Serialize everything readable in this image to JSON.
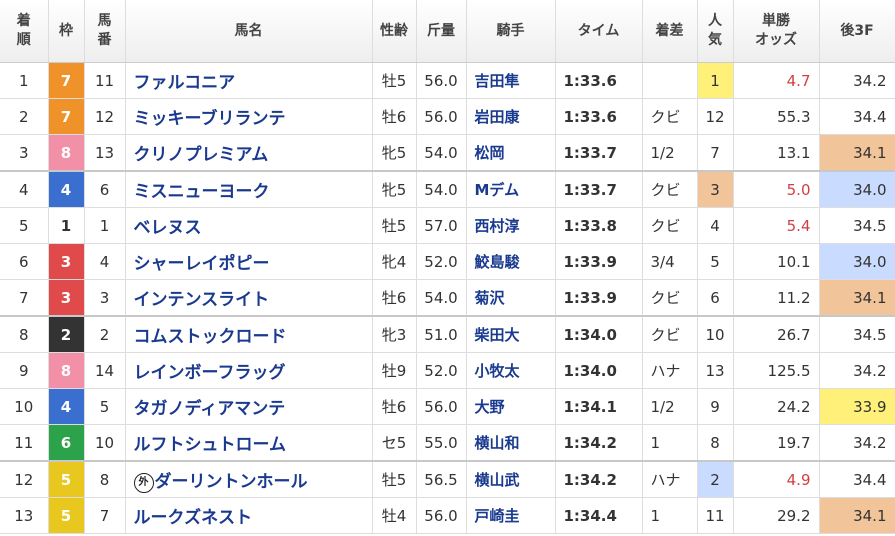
{
  "headers": {
    "rank": [
      "着",
      "順"
    ],
    "waku": "枠",
    "umaban": [
      "馬",
      "番"
    ],
    "name": "馬名",
    "sexage": "性齢",
    "weight": "斤量",
    "jockey": "騎手",
    "time": "タイム",
    "margin": "着差",
    "pop": [
      "人",
      "気"
    ],
    "odds": [
      "単勝",
      "オッズ"
    ],
    "last3f": "後3F"
  },
  "colors": {
    "waku_1": "#ffffff",
    "waku_2": "#333333",
    "waku_3": "#e04a4a",
    "waku_4": "#3a6fd0",
    "waku_5": "#e8c81e",
    "waku_6": "#2ca34a",
    "waku_7": "#f0922a",
    "waku_8": "#f290a8",
    "pop1_bg": "#fff07a",
    "pop2_bg": "#c9dcff",
    "pop3_bg": "#f2c49a",
    "f1_bg": "#fff07a",
    "f2_bg": "#c9dcff",
    "f3_bg": "#f2c49a"
  },
  "rows": [
    {
      "rank": "1",
      "waku": "7",
      "umaban": "11",
      "name": "ファルコニア",
      "gai": "",
      "sexage": "牡5",
      "weight": "56.0",
      "jockey": "吉田隼",
      "time": "1:33.6",
      "margin": "",
      "pop": "1",
      "odds": "4.7",
      "last3f": "34.2"
    },
    {
      "rank": "2",
      "waku": "7",
      "umaban": "12",
      "name": "ミッキーブリランテ",
      "gai": "",
      "sexage": "牡6",
      "weight": "56.0",
      "jockey": "岩田康",
      "time": "1:33.6",
      "margin": "クビ",
      "pop": "12",
      "odds": "55.3",
      "last3f": "34.4"
    },
    {
      "rank": "3",
      "waku": "8",
      "umaban": "13",
      "name": "クリノプレミアム",
      "gai": "",
      "sexage": "牝5",
      "weight": "54.0",
      "jockey": "松岡",
      "time": "1:33.7",
      "margin": "1/2",
      "pop": "7",
      "odds": "13.1",
      "last3f": "34.1"
    },
    {
      "rank": "4",
      "waku": "4",
      "umaban": "6",
      "name": "ミスニューヨーク",
      "gai": "",
      "sexage": "牝5",
      "weight": "54.0",
      "jockey": "Mデム",
      "time": "1:33.7",
      "margin": "クビ",
      "pop": "3",
      "odds": "5.0",
      "last3f": "34.0"
    },
    {
      "rank": "5",
      "waku": "1",
      "umaban": "1",
      "name": "ベレヌス",
      "gai": "",
      "sexage": "牡5",
      "weight": "57.0",
      "jockey": "西村淳",
      "time": "1:33.8",
      "margin": "クビ",
      "pop": "4",
      "odds": "5.4",
      "last3f": "34.5"
    },
    {
      "rank": "6",
      "waku": "3",
      "umaban": "4",
      "name": "シャーレイポピー",
      "gai": "",
      "sexage": "牝4",
      "weight": "52.0",
      "jockey": "鮫島駿",
      "time": "1:33.9",
      "margin": "3/4",
      "pop": "5",
      "odds": "10.1",
      "last3f": "34.0"
    },
    {
      "rank": "7",
      "waku": "3",
      "umaban": "3",
      "name": "インテンスライト",
      "gai": "",
      "sexage": "牡6",
      "weight": "54.0",
      "jockey": "菊沢",
      "time": "1:33.9",
      "margin": "クビ",
      "pop": "6",
      "odds": "11.2",
      "last3f": "34.1"
    },
    {
      "rank": "8",
      "waku": "2",
      "umaban": "2",
      "name": "コムストックロード",
      "gai": "",
      "sexage": "牝3",
      "weight": "51.0",
      "jockey": "柴田大",
      "time": "1:34.0",
      "margin": "クビ",
      "pop": "10",
      "odds": "26.7",
      "last3f": "34.5"
    },
    {
      "rank": "9",
      "waku": "8",
      "umaban": "14",
      "name": "レインボーフラッグ",
      "gai": "",
      "sexage": "牡9",
      "weight": "52.0",
      "jockey": "小牧太",
      "time": "1:34.0",
      "margin": "ハナ",
      "pop": "13",
      "odds": "125.5",
      "last3f": "34.2"
    },
    {
      "rank": "10",
      "waku": "4",
      "umaban": "5",
      "name": "タガノディアマンテ",
      "gai": "",
      "sexage": "牡6",
      "weight": "56.0",
      "jockey": "大野",
      "time": "1:34.1",
      "margin": "1/2",
      "pop": "9",
      "odds": "24.2",
      "last3f": "33.9"
    },
    {
      "rank": "11",
      "waku": "6",
      "umaban": "10",
      "name": "ルフトシュトローム",
      "gai": "",
      "sexage": "セ5",
      "weight": "55.0",
      "jockey": "横山和",
      "time": "1:34.2",
      "margin": "1",
      "pop": "8",
      "odds": "19.7",
      "last3f": "34.2"
    },
    {
      "rank": "12",
      "waku": "5",
      "umaban": "8",
      "name": "ダーリントンホール",
      "gai": "外",
      "sexage": "牡5",
      "weight": "56.5",
      "jockey": "横山武",
      "time": "1:34.2",
      "margin": "ハナ",
      "pop": "2",
      "odds": "4.9",
      "last3f": "34.4"
    },
    {
      "rank": "13",
      "waku": "5",
      "umaban": "7",
      "name": "ルークズネスト",
      "gai": "",
      "sexage": "牡4",
      "weight": "56.0",
      "jockey": "戸崎圭",
      "time": "1:34.4",
      "margin": "1",
      "pop": "11",
      "odds": "29.2",
      "last3f": "34.1"
    }
  ]
}
